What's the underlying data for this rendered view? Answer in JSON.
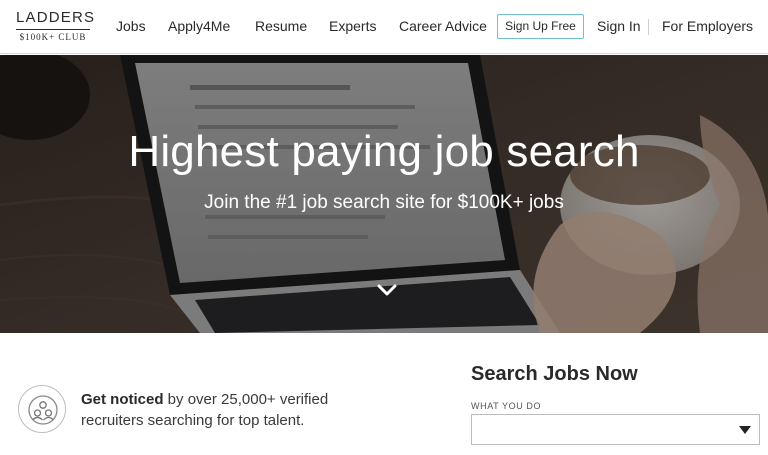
{
  "nav": {
    "logo_top": "LADDERS",
    "logo_bottom": "$100K+ CLUB",
    "links": [
      "Jobs",
      "Apply4Me",
      "Resume",
      "Experts",
      "Career Advice"
    ],
    "signup_label": "Sign Up Free",
    "signin_label": "Sign In",
    "employers_label": "For Employers"
  },
  "hero": {
    "title": "Highest paying job search",
    "subtitle": "Join the #1 job search site for $100K+ jobs",
    "scroll_icon": "chevron-down-icon"
  },
  "notice": {
    "icon": "people-group-icon",
    "bold_text": "Get noticed",
    "text": " by over 25,000+ verified recruiters searching for top talent."
  },
  "search": {
    "title": "Search Jobs Now",
    "field_label": "WHAT YOU DO",
    "select_value": ""
  },
  "colors": {
    "accent_border": "#6fc2d6",
    "text": "#2a2a2a"
  }
}
